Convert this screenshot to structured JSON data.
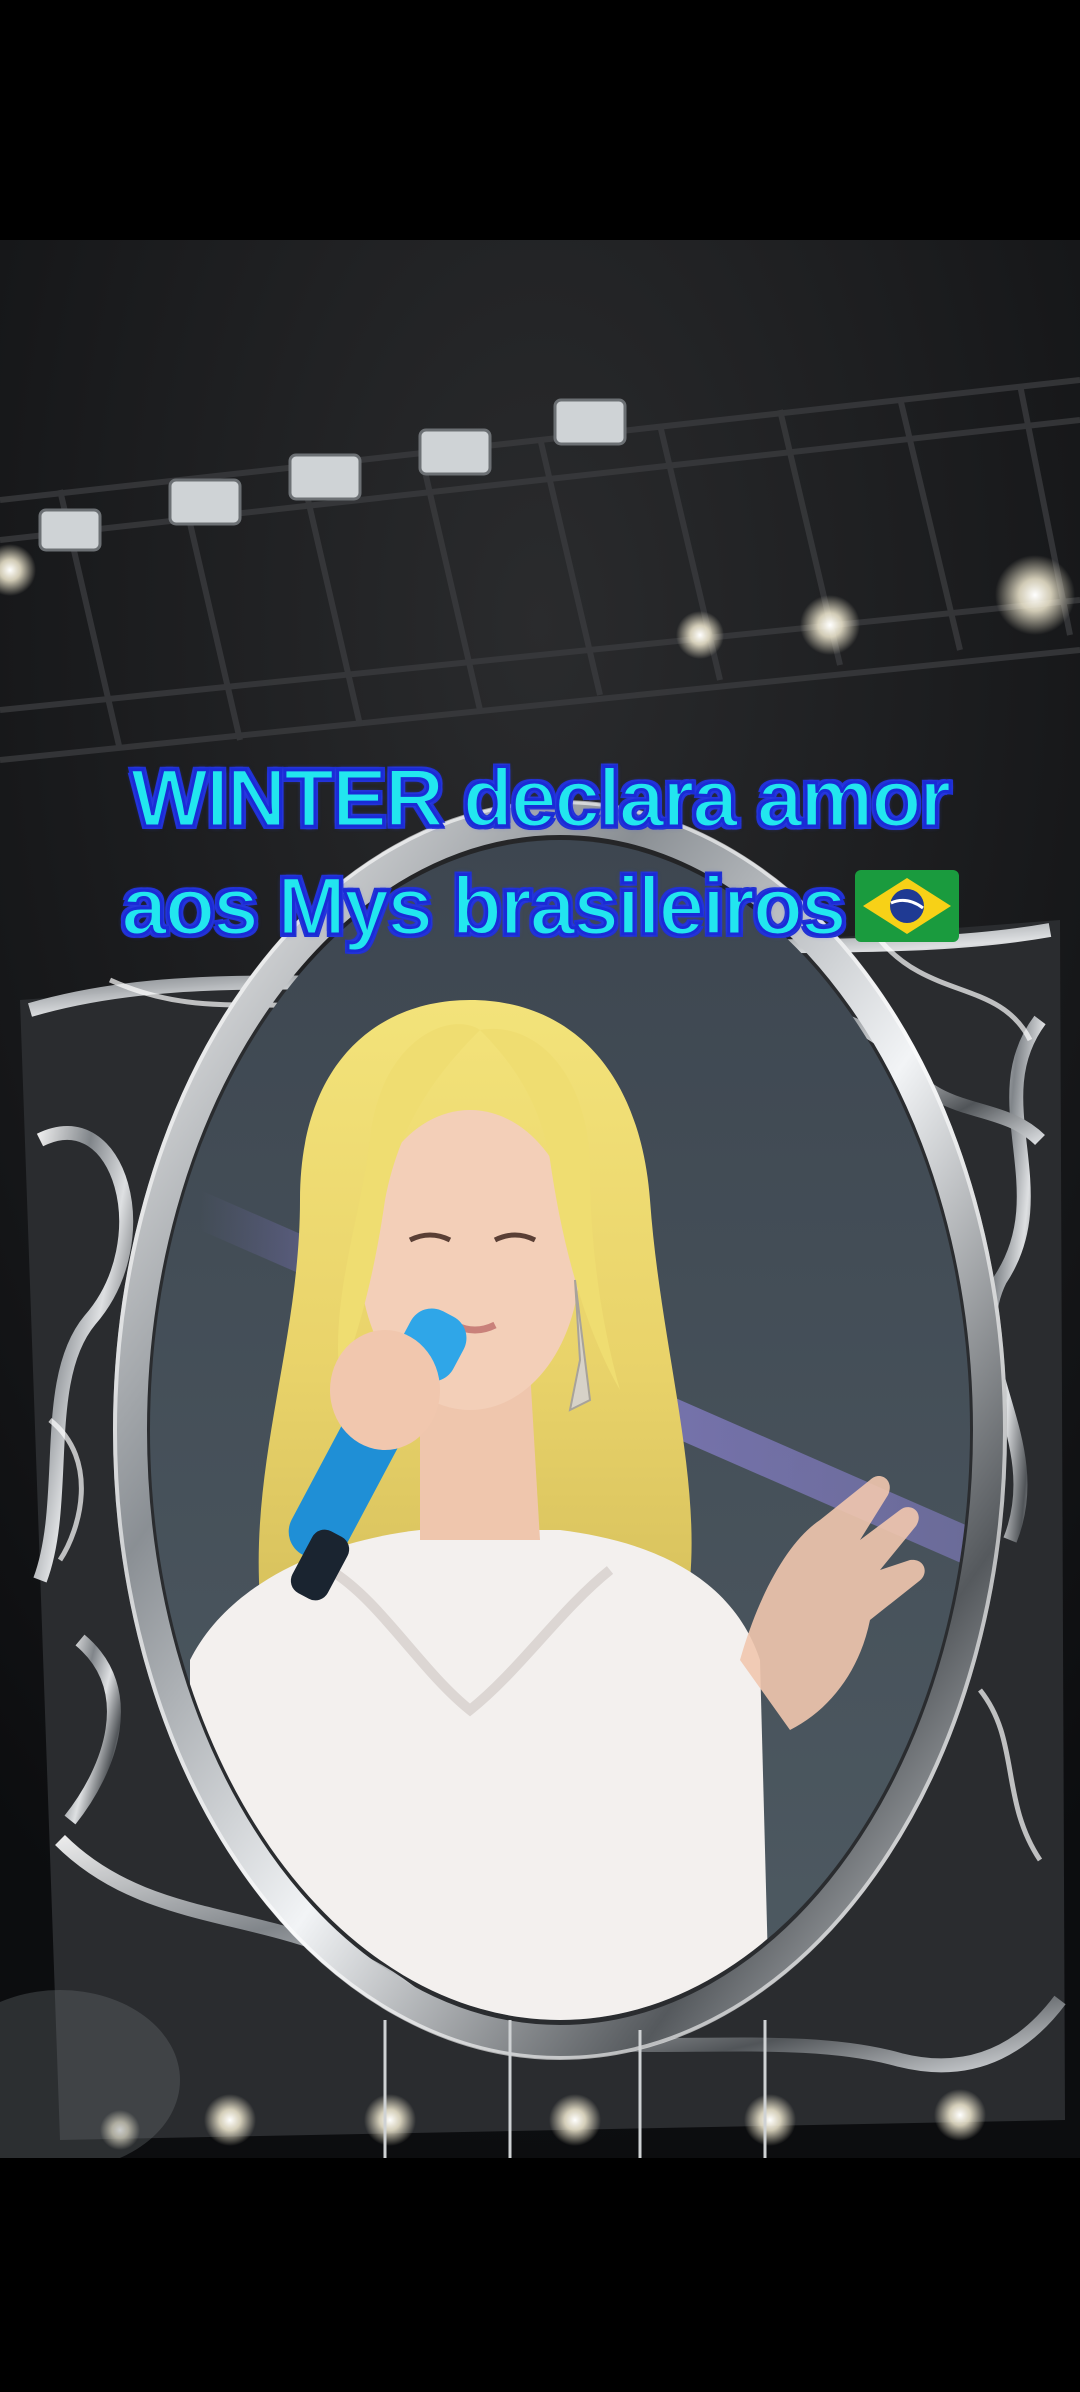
{
  "video": {
    "caption_line_1": "WINTER declara amor",
    "caption_line_2": "aos Mys brasileiros",
    "caption_emoji_icon": "brazil-flag-icon",
    "colors": {
      "caption_fill": "#22e6ef",
      "caption_stroke": "#1a2bd6",
      "letterbox": "#000000"
    }
  }
}
